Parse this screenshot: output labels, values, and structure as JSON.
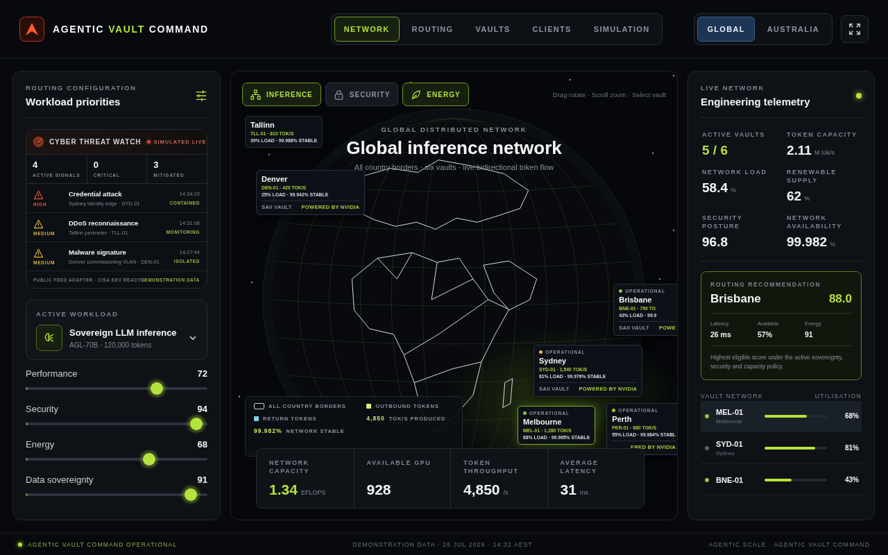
{
  "header": {
    "title_parts": [
      {
        "text": "AGENTIC",
        "accent": false
      },
      {
        "text": "VAULT",
        "accent": true
      },
      {
        "text": "COMMAND",
        "accent": false
      }
    ],
    "nav": [
      {
        "label": "NETWORK",
        "selected": true
      },
      {
        "label": "ROUTING",
        "selected": false
      },
      {
        "label": "VAULTS",
        "selected": false
      },
      {
        "label": "CLIENTS",
        "selected": false
      },
      {
        "label": "SIMULATION",
        "selected": false
      }
    ],
    "regions": [
      {
        "label": "GLOBAL",
        "selected": true
      },
      {
        "label": "AUSTRALIA",
        "selected": false
      }
    ]
  },
  "routing_panel": {
    "eyebrow": "ROUTING CONFIGURATION",
    "title": "Workload priorities",
    "threat_watch": {
      "title": "CYBER THREAT WATCH",
      "live_label": "SIMULATED LIVE",
      "stats": [
        {
          "value": "4",
          "label": "ACTIVE SIGNALS"
        },
        {
          "value": "0",
          "label": "CRITICAL"
        },
        {
          "value": "3",
          "label": "MITIGATED"
        }
      ],
      "threats": [
        {
          "kind": "high",
          "severity": "HIGH",
          "title": "Credential attack",
          "source": "Sydney identity edge · SYD-01",
          "time": "14:34:19",
          "status": "CONTAINED"
        },
        {
          "kind": "medium",
          "severity": "MEDIUM",
          "title": "DDoS reconnaissance",
          "source": "Tallinn perimeter · TLL-01",
          "time": "14:31:08",
          "status": "MONITORING"
        },
        {
          "kind": "medium",
          "severity": "MEDIUM",
          "title": "Malware signature",
          "source": "Denver commissioning VLAN · DEN-01",
          "time": "14:27:44",
          "status": "ISOLATED"
        }
      ],
      "footer_left": "PUBLIC FEED ADAPTER · CISA KEV READY",
      "footer_right": "DEMONSTRATION DATA"
    },
    "workload": {
      "eyebrow": "ACTIVE WORKLOAD",
      "name": "Sovereign LLM inference",
      "detail": "AGL-70B · 120,000 tokens"
    },
    "priorities": [
      {
        "label": "Performance",
        "value": "72",
        "level": 0.72
      },
      {
        "label": "Security",
        "value": "94",
        "level": 0.94
      },
      {
        "label": "Energy",
        "value": "68",
        "level": 0.68
      },
      {
        "label": "Data sovereignty",
        "value": "91",
        "level": 0.91
      }
    ]
  },
  "network_view": {
    "layers": [
      {
        "label": "INFERENCE",
        "kind": "inference",
        "on": true
      },
      {
        "label": "SECURITY",
        "kind": "security",
        "on": false
      },
      {
        "label": "ENERGY",
        "kind": "energy",
        "on": true
      }
    ],
    "hint": "Drag rotate · Scroll zoom · Select vault",
    "eyebrow": "GLOBAL DISTRIBUTED NETWORK",
    "title": "Global inference network",
    "subtitle": "All country borders · six vaults · live bidirectional token flow",
    "vaults": [
      {
        "name": "Tallinn",
        "code": "TLL-01 · 610 TOK/S",
        "load": "39% LOAD · 99.988% STABLE",
        "selected": false
      },
      {
        "name": "Denver",
        "code": "DEN-01 · 420 TOK/S",
        "load": "25% LOAD · 99.942% STABLE",
        "footer": {
          "vault": "SAII VAULT",
          "brand": "POWERED BY NVIDIA"
        },
        "selected": false
      },
      {
        "status": "OPERATIONAL",
        "color": "#8fc93a",
        "name": "Brisbane",
        "code": "BNE-01 · 790 TO",
        "load": "43% LOAD · 99.9",
        "footer": {
          "vault": "SAII VAULT",
          "brand": "POWE"
        },
        "selected": false
      },
      {
        "status": "OPERATIONAL",
        "color": "#e3c13b",
        "name": "Sydney",
        "code": "SYD-01 · 1,540 TOK/S",
        "load": "81% LOAD · 99.976% STABLE",
        "footer": {
          "vault": "SAII VAULT",
          "brand": "POWERED BY NVIDIA"
        },
        "selected": false
      },
      {
        "status": "OPERATIONAL",
        "color": "#8fc93a",
        "name": "Melbourne",
        "code": "MEL-01 · 1,280 TOK/S",
        "load": "68% LOAD · 99.995% STABLE",
        "selected": true
      },
      {
        "status": "OPERATIONAL",
        "color": "#8fc93a",
        "name": "Perth",
        "code": "PER-01 · 680 TOK/S",
        "load": "55% LOAD · 99.984% STABL",
        "footer": {
          "brand": "ERED BY NVIDIA"
        },
        "selected": false
      }
    ],
    "legend": {
      "items": [
        {
          "label": "ALL COUNTRY BORDERS",
          "kind": "border"
        },
        {
          "label": "OUTBOUND TOKENS",
          "kind": "outbound"
        },
        {
          "label": "RETURN TOKENS",
          "kind": "return"
        }
      ],
      "throughput": {
        "value": "4,850",
        "label": "TOK/S PRODUCED"
      },
      "stability": {
        "value": "99.982%",
        "label": "NETWORK STABLE"
      }
    },
    "stats": [
      {
        "label": "NETWORK CAPACITY",
        "value": "1.34",
        "unit": "EFLOPS",
        "accent": true
      },
      {
        "label": "AVAILABLE GPU",
        "value": "928",
        "accent": false
      },
      {
        "label": "TOKEN THROUGHPUT",
        "value": "4,850",
        "unit": "/s",
        "accent": false
      },
      {
        "label": "AVERAGE LATENCY",
        "value": "31",
        "unit": "ms",
        "accent": false
      }
    ]
  },
  "telemetry": {
    "eyebrow": "LIVE NETWORK",
    "title": "Engineering telemetry",
    "live": true,
    "metrics": [
      {
        "label": "ACTIVE VAULTS",
        "value": "5 / 6",
        "accent": true
      },
      {
        "label": "TOKEN CAPACITY",
        "value": "2.11",
        "unit": "M tok/s",
        "accent": false
      },
      {
        "label": "NETWORK LOAD",
        "value": "58.4",
        "unit": "%",
        "accent": false
      },
      {
        "label": "RENEWABLE SUPPLY",
        "value": "62",
        "unit": "%",
        "accent": false
      },
      {
        "label": "SECURITY POSTURE",
        "value": "96.8",
        "accent": false
      },
      {
        "label": "NETWORK AVAILABILITY",
        "value": "99.982",
        "unit": "%",
        "accent": false
      }
    ],
    "recommendation": {
      "label": "ROUTING RECOMMENDATION",
      "name": "Brisbane",
      "score": "88.0",
      "stats": [
        {
          "label": "Latency",
          "value": "26 ms"
        },
        {
          "label": "Available",
          "value": "57%"
        },
        {
          "label": "Energy",
          "value": "91"
        }
      ],
      "note": "Highest eligible score under the active sovereignty, security and capacity policy."
    },
    "vault_list": {
      "heading": "VAULT NETWORK",
      "column": "UTILISATION",
      "rows": [
        {
          "code": "MEL-01",
          "city": "Melbourne",
          "level": 0.68,
          "reading": "68%",
          "color": "#8fc93a",
          "selected": true
        },
        {
          "code": "SYD-01",
          "city": "Sydney",
          "level": 0.81,
          "reading": "81%",
          "color": "#5b6470",
          "selected": false
        },
        {
          "code": "BNE-01",
          "level": 0.43,
          "reading": "43%",
          "color": "#8fc93a",
          "selected": false
        }
      ]
    }
  },
  "footer": {
    "status": "AGENTIC VAULT COMMAND OPERATIONAL",
    "center": "DEMONSTRATION DATA · 26 JUL 2026 · 14:32 AEST",
    "right": "AGENTIC SCALE · AGENTIC VAULT COMMAND"
  }
}
